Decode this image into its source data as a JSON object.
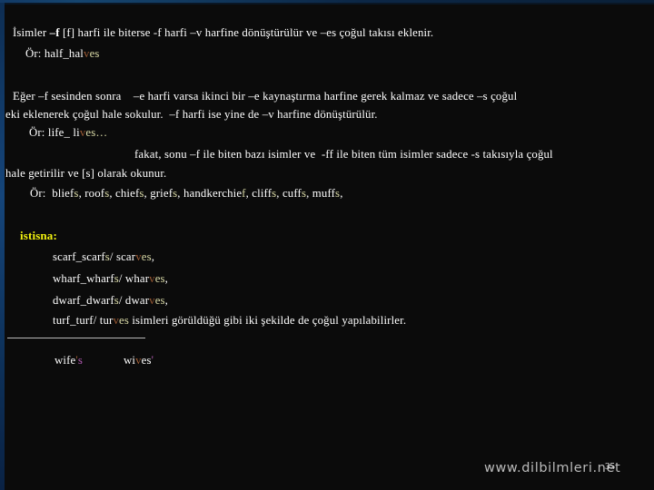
{
  "slide": {
    "page_number": "35",
    "background_color": "#0b0b0b",
    "accent_border_color": "#15457a",
    "text_color": "#ffffff",
    "highlight_yellow": "#d9d9a6",
    "highlight_red": "#9c5a33",
    "highlight_magenta": "#b45bb4",
    "istisna_color": "#f2f20f"
  },
  "body": {
    "rule1_a": "İsimler ",
    "rule1_b": "–f",
    "rule1_c": " [f] harfi ile biterse -f harfi –v harfine dönüştürülür ve –es çoğul takısı eklenir.",
    "example1_label": "Ör: half_hal",
    "example1_v": "v",
    "example1_es": "es",
    "rule2_line1": "Eğer –f sesinden sonra    –e harfi varsa ikinci bir –e kaynaştırma harfine gerek kalmaz ve sadece –s çoğul",
    "rule2_line2": "eki eklenerek çoğul hale sokulur.  –f harfi ise yine de –v harfine dönüştürülür.",
    "example2_label": "Ör: life_ li",
    "example2_v": "v",
    "example2_es": "es…",
    "rule3_line1": "fakat, sonu –f ile biten bazı isimler ve  -ff ile biten tüm isimler sadece -s takısıyla çoğul",
    "rule3_line2": "hale getirilir ve [s] olarak okunur.",
    "example3_prefix": "Ör:  blief",
    "example3_items": [
      {
        "stem": "blief",
        "suffix": "s",
        "sep": ", "
      },
      {
        "stem": "roof",
        "suffix": "s",
        "sep": ", "
      },
      {
        "stem": "chief",
        "suffix": "s",
        "sep": ", "
      },
      {
        "stem": "grief",
        "suffix": "s",
        "sep": ", "
      },
      {
        "stem": "handkerchie",
        "suffix": "f",
        "sep": ", "
      },
      {
        "stem": "cliff",
        "suffix": "s",
        "sep": ", "
      },
      {
        "stem": "cuff",
        "suffix": "s",
        "sep": ", "
      },
      {
        "stem": "muff",
        "suffix": "s",
        "sep": ","
      }
    ],
    "istisna_label": "istisna:",
    "exceptions": [
      {
        "base": "scarf_scarf",
        "base_s": "s",
        "slash": "/ scar",
        "v": "v",
        "tail": "es",
        "comma": ","
      },
      {
        "base": "wharf_wharf",
        "base_s": "s",
        "slash": "/ whar",
        "v": "v",
        "tail": "es",
        "comma": ","
      },
      {
        "base": "dwarf_dwarf",
        "base_s": "s",
        "slash": "/ dwar",
        "v": "v",
        "tail": "es",
        "comma": ","
      },
      {
        "base": "turf_turf",
        "base_s": "",
        "slash": "/ tur",
        "v": "v",
        "tail": "es",
        "comma": ""
      }
    ],
    "exception_note": " isimleri görüldüğü gibi iki şekilde de çoğul yapılabilirler.",
    "possessive_1_stem": "wife",
    "possessive_1_apos": "'",
    "possessive_1_s": "s",
    "possessive_2_stem_a": "wi",
    "possessive_2_v": "v",
    "possessive_2_stem_b": "es",
    "possessive_2_apos": "'"
  },
  "footer": {
    "watermark": "www.dilbilmleri.net",
    "page": "35"
  }
}
